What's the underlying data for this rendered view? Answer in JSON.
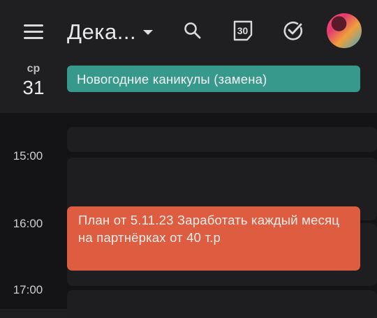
{
  "header": {
    "title": "Дека...",
    "today_day": "30",
    "icons": [
      "menu-icon",
      "search-icon",
      "calendar-today-icon",
      "tasks-check-icon"
    ]
  },
  "day": {
    "weekday": "ср",
    "number": "31"
  },
  "all_day_event": {
    "title": "Новогодние каникулы (замена)",
    "color": "#36998c"
  },
  "timeline": {
    "hours": [
      "15:00",
      "16:00",
      "17:00"
    ]
  },
  "event": {
    "title": "План от 5.11.23 Заработать каждый месяц на партнёрках от 40 т.р",
    "color": "#de5c40"
  }
}
